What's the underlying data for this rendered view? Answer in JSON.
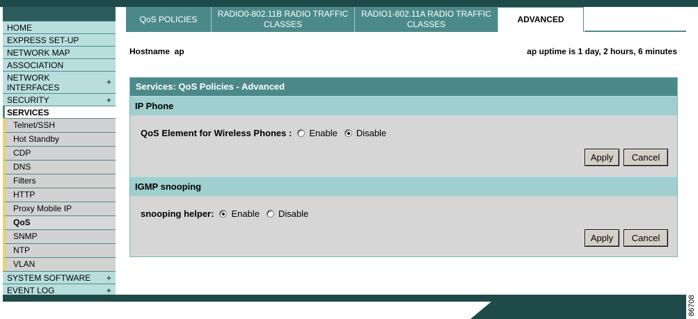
{
  "sidebar": {
    "items": [
      {
        "label": "HOME",
        "plus": ""
      },
      {
        "label": "EXPRESS SET-UP",
        "plus": ""
      },
      {
        "label": "NETWORK MAP",
        "plus": ""
      },
      {
        "label": "ASSOCIATION",
        "plus": ""
      },
      {
        "label": "NETWORK INTERFACES",
        "plus": "+"
      },
      {
        "label": "SECURITY",
        "plus": "+"
      },
      {
        "label": "SERVICES",
        "plus": ""
      }
    ],
    "sub_items": [
      "Telnet/SSH",
      "Hot Standby",
      "CDP",
      "DNS",
      "Filters",
      "HTTP",
      "Proxy Mobile IP",
      "QoS",
      "SNMP",
      "NTP",
      "VLAN"
    ],
    "bottom_items": [
      {
        "label": "SYSTEM SOFTWARE",
        "plus": "+"
      },
      {
        "label": "EVENT LOG",
        "plus": "+"
      }
    ]
  },
  "tabs": [
    "QoS POLICIES",
    "RADIO0-802.11B RADIO TRAFFIC CLASSES",
    "RADIO1-802.11A RADIO TRAFFIC CLASSES",
    "ADVANCED"
  ],
  "header": {
    "hostname": "Hostname  ap",
    "uptime": "ap uptime is 1 day, 2 hours, 6 minutes"
  },
  "panel": {
    "title": "Services: QoS Policies - Advanced",
    "ip_phone": {
      "heading": "IP Phone",
      "label": "QoS Element for Wireless Phones :",
      "enable": "Enable",
      "disable": "Disable",
      "selected": "Disable",
      "apply": "Apply",
      "cancel": "Cancel"
    },
    "igmp": {
      "heading": "IGMP snooping",
      "label": "snooping helper:",
      "enable": "Enable",
      "disable": "Disable",
      "selected": "Enable",
      "apply": "Apply",
      "cancel": "Cancel"
    }
  },
  "figure_number": "86708",
  "colors": {
    "dark_teal": "#1f4a4a",
    "teal": "#4c8a8a",
    "light_teal": "#9fcfcf",
    "nav_bg": "#b9dede",
    "panel_bg": "#d6d6d6"
  }
}
